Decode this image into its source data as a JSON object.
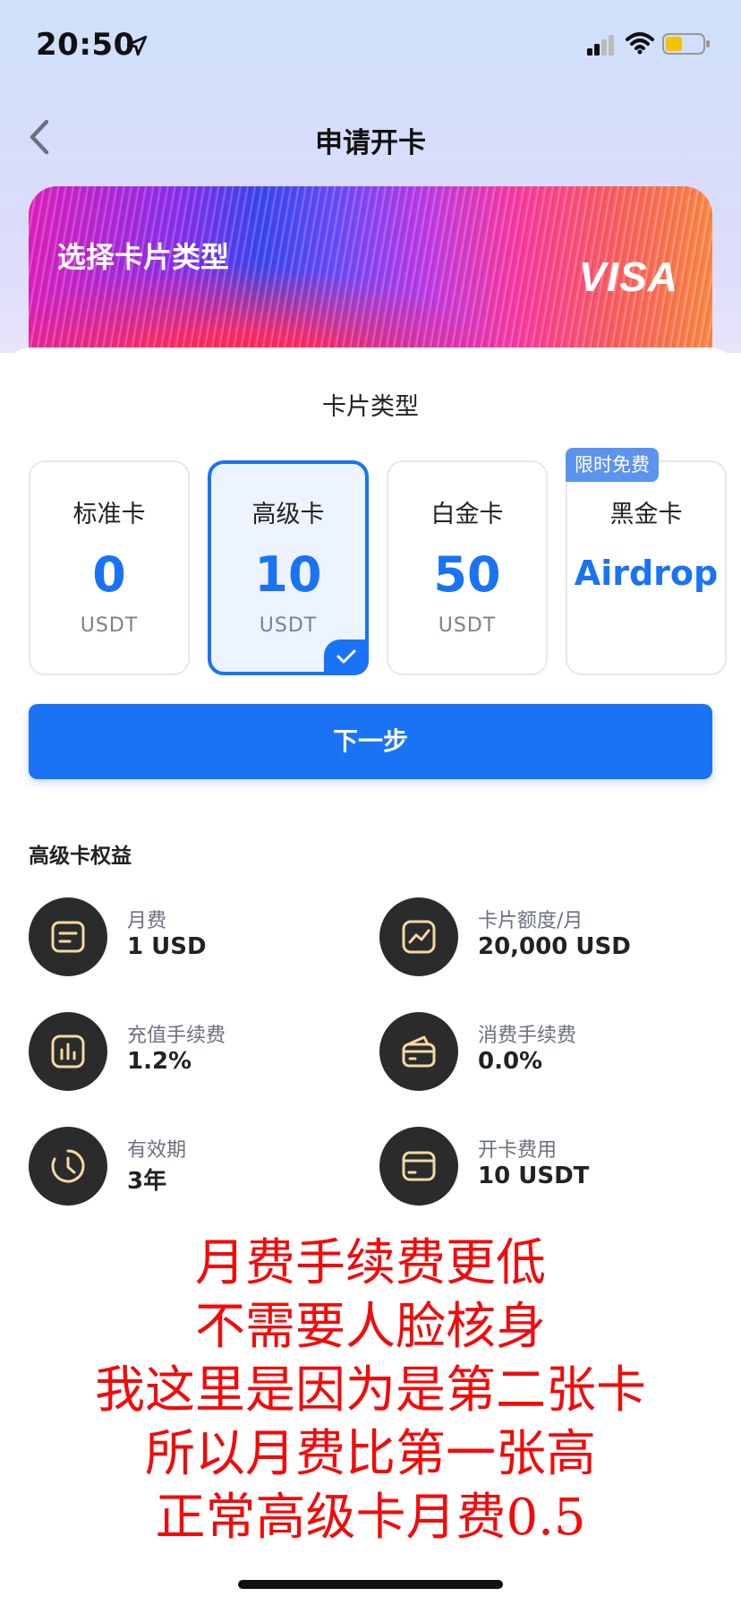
{
  "status_bar": {
    "time": "20:50"
  },
  "nav": {
    "title": "申请开卡"
  },
  "hero": {
    "title": "选择卡片类型",
    "brand": "VISA"
  },
  "card_type": {
    "section_title": "卡片类型",
    "tiers": [
      {
        "name": "标准卡",
        "price": "0",
        "unit": "USDT",
        "selected": false
      },
      {
        "name": "高级卡",
        "price": "10",
        "unit": "USDT",
        "selected": true
      },
      {
        "name": "白金卡",
        "price": "50",
        "unit": "USDT",
        "selected": false
      },
      {
        "name": "黑金卡",
        "price": "Airdrop",
        "tag": "限时免费",
        "selected": false
      }
    ]
  },
  "next_button": {
    "label": "下一步"
  },
  "benefits": {
    "title": "高级卡权益",
    "items": [
      {
        "label": "月费",
        "value": "1 USD",
        "icon": "list-doc-icon"
      },
      {
        "label": "卡片额度/月",
        "value": "20,000 USD",
        "icon": "trend-chart-icon"
      },
      {
        "label": "充值手续费",
        "value": "1.2%",
        "icon": "bar-chart-icon"
      },
      {
        "label": "消费手续费",
        "value": "0.0%",
        "icon": "wallet-card-icon"
      },
      {
        "label": "有效期",
        "value": "3年",
        "icon": "clock-icon"
      },
      {
        "label": "开卡费用",
        "value": "10 USDT",
        "icon": "card-icon"
      }
    ]
  },
  "overlay_text": {
    "lines": [
      "月费手续费更低",
      "不需要人脸核身",
      "我这里是因为是第二张卡",
      "所以月费比第一张高",
      "正常高级卡月费0.5"
    ]
  },
  "colors": {
    "accent": "#1a73f5",
    "overlay_red": "#f20b0b",
    "icon_bg": "#2b2b2b",
    "icon_stroke": "#f3d9a4"
  }
}
